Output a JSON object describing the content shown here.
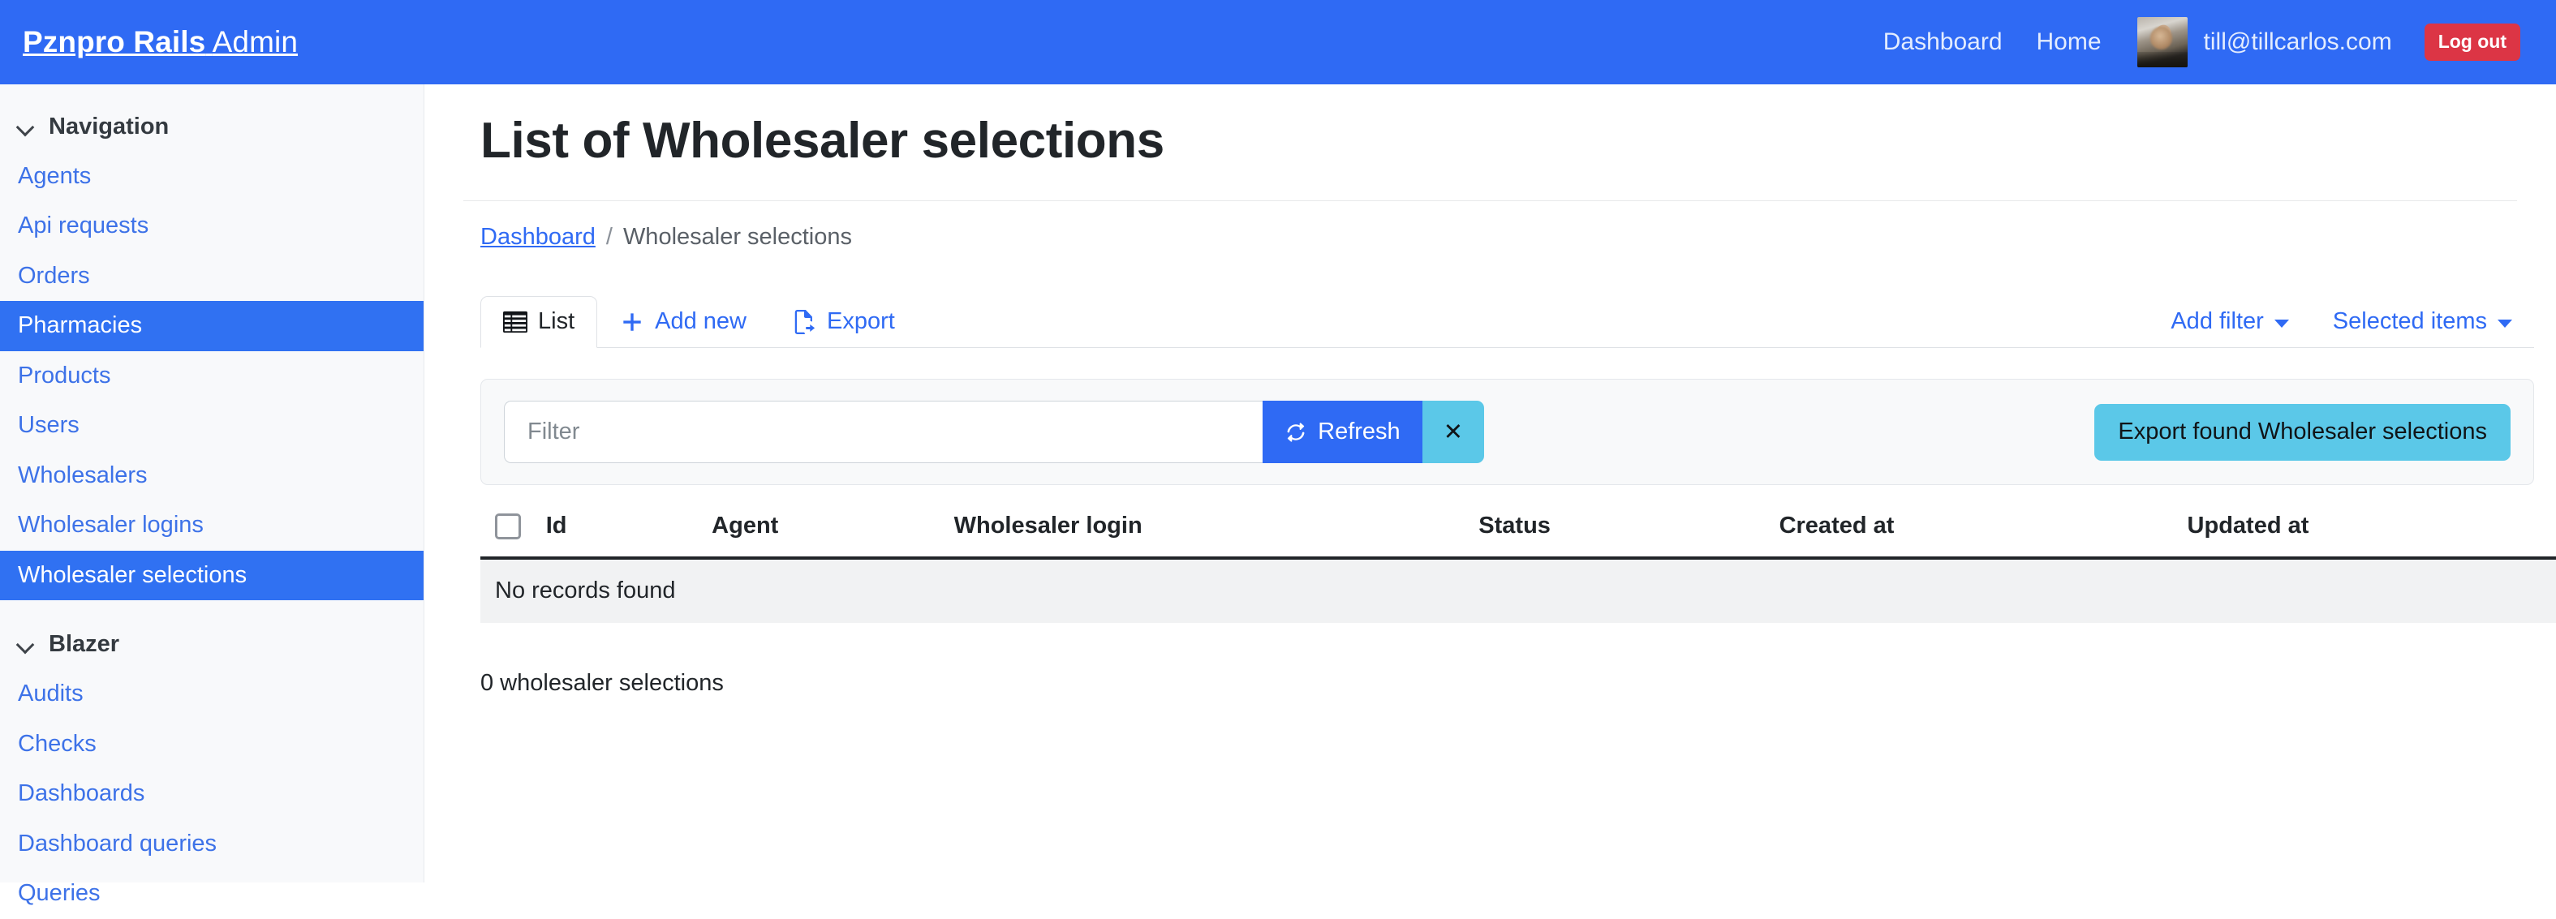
{
  "navbar": {
    "brand_bold": "Pznpro Rails",
    "brand_light": "Admin",
    "links": [
      {
        "label": "Dashboard",
        "name": "nav-link-dashboard"
      },
      {
        "label": "Home",
        "name": "nav-link-home"
      }
    ],
    "user_email": "till@tillcarlos.com",
    "logout_label": "Log out",
    "background_color": "#2f6af4",
    "logout_color": "#dc3545"
  },
  "sidebar": {
    "sections": [
      {
        "title": "Navigation",
        "items": [
          {
            "label": "Agents",
            "active": false
          },
          {
            "label": "Api requests",
            "active": false
          },
          {
            "label": "Orders",
            "active": false
          },
          {
            "label": "Pharmacies",
            "active": true
          },
          {
            "label": "Products",
            "active": false
          },
          {
            "label": "Users",
            "active": false
          },
          {
            "label": "Wholesalers",
            "active": false
          },
          {
            "label": "Wholesaler logins",
            "active": false
          },
          {
            "label": "Wholesaler selections",
            "active": true
          }
        ]
      },
      {
        "title": "Blazer",
        "items": [
          {
            "label": "Audits",
            "active": false
          },
          {
            "label": "Checks",
            "active": false
          },
          {
            "label": "Dashboards",
            "active": false
          },
          {
            "label": "Dashboard queries",
            "active": false
          },
          {
            "label": "Queries",
            "active": false
          }
        ]
      }
    ],
    "active_color": "#3071f2",
    "link_color": "#3d72e8"
  },
  "main": {
    "page_title": "List of Wholesaler selections",
    "breadcrumb": {
      "root": "Dashboard",
      "separator": "/",
      "current": "Wholesaler selections"
    },
    "tabs": [
      {
        "label": "List",
        "icon": "table-icon",
        "active": true
      },
      {
        "label": "Add new",
        "icon": "plus-icon",
        "active": false
      },
      {
        "label": "Export",
        "icon": "file-export-icon",
        "active": false
      }
    ],
    "tab_dropdowns": [
      {
        "label": "Add filter",
        "icon": "caret-down-icon"
      },
      {
        "label": "Selected items",
        "icon": "caret-down-icon"
      }
    ],
    "filter": {
      "placeholder": "Filter",
      "value": "",
      "refresh_label": "Refresh",
      "refresh_icon": "refresh-icon",
      "clear_label": "✕",
      "export_found_label": "Export found Wholesaler selections",
      "refresh_color": "#2f6af4",
      "export_color": "#5bc8e8"
    },
    "table": {
      "columns": [
        "Id",
        "Agent",
        "Wholesaler login",
        "Status",
        "Created at",
        "Updated at"
      ],
      "rows": [],
      "empty_message": "No records found"
    },
    "record_count": "0 wholesaler selections"
  }
}
